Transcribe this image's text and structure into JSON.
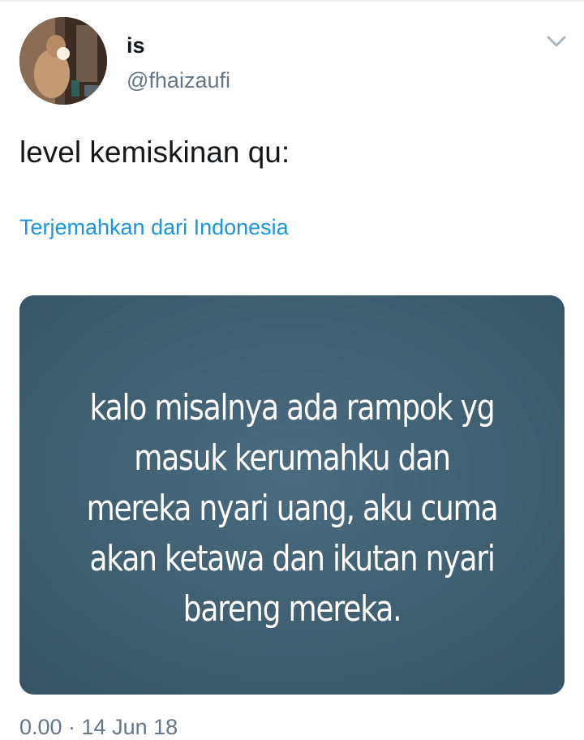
{
  "user": {
    "display_name": "is",
    "handle": "@fhaizaufi"
  },
  "tweet": {
    "text": "level kemiskinan qu:",
    "translate_link": "Terjemahkan dari Indonesia",
    "timestamp_partial": "0.00 · 14 Jun 18"
  },
  "media": {
    "text": "kalo misalnya ada rampok yg\nmasuk kerumahku dan\nmereka nyari uang, aku cuma\nakan ketawa dan ikutan nyari\nbareng mereka."
  },
  "icons": {
    "avatar": "profile-photo",
    "menu": "chevron-down-icon"
  },
  "colors": {
    "text_primary": "#14171a",
    "text_secondary": "#657786",
    "link": "#1b95e0",
    "media_background": "#3e5e73"
  }
}
